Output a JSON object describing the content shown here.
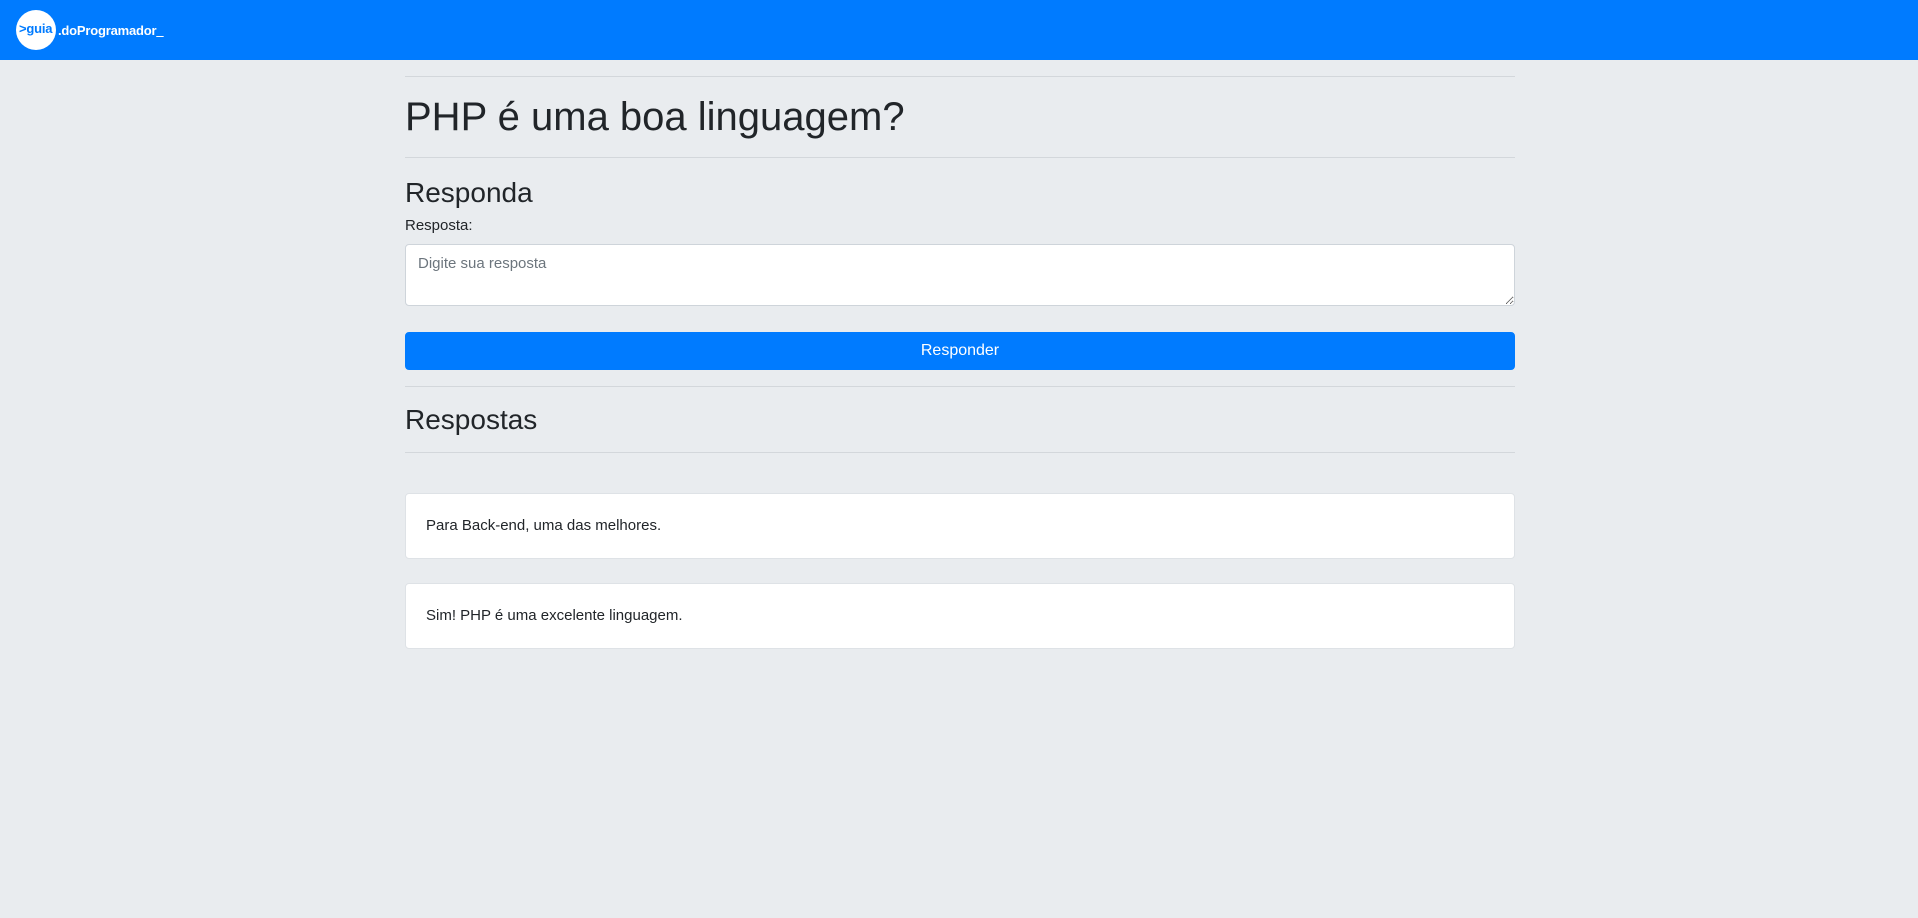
{
  "brand": {
    "prefix": ">guia",
    "rest": ".doProgramador",
    "cursor": "_"
  },
  "question": {
    "title": "PHP é uma boa linguagem?"
  },
  "answer_form": {
    "heading": "Responda",
    "label": "Resposta:",
    "placeholder": "Digite sua resposta",
    "value": "",
    "submit_label": "Responder"
  },
  "answers": {
    "heading": "Respostas",
    "items": [
      {
        "text": "Para Back-end, uma das melhores."
      },
      {
        "text": "Sim! PHP é uma excelente linguagem."
      }
    ]
  },
  "colors": {
    "primary": "#007bff",
    "page_background": "#e9ecef",
    "card_background": "#ffffff",
    "text": "#212529",
    "placeholder": "#6c757d"
  }
}
